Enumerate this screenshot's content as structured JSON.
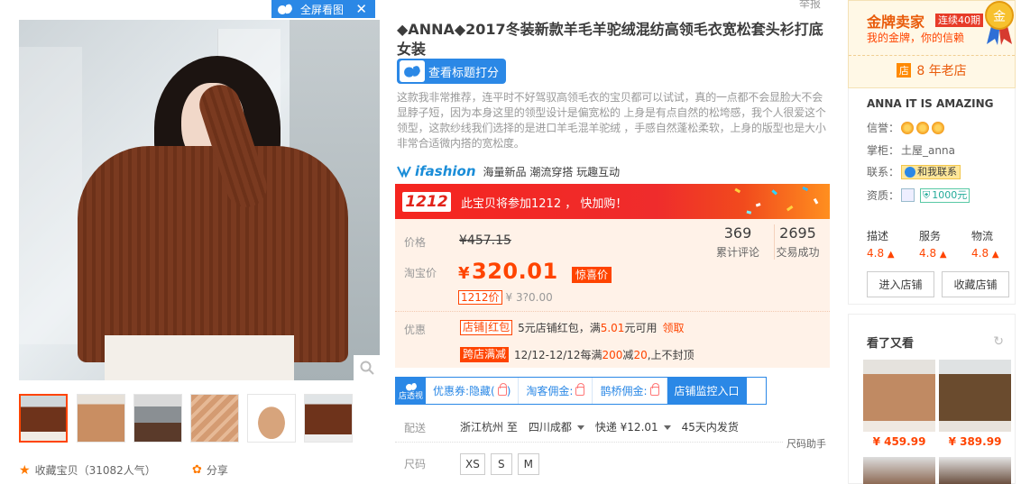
{
  "gallery": {
    "fullscreen_label": "全屏看图",
    "favorite_label": "收藏宝贝（31082人气）",
    "share_label": "分享"
  },
  "report_label": "举报",
  "title": "◆ANNA◆2017冬装新款羊毛羊驼绒混纺高领毛衣宽松套头衫打底女装",
  "score_button": "查看标题打分",
  "description": "这款我非常推荐，连平时不好驾驭高领毛衣的宝贝都可以试试，真的一点都不会显脸大不会显脖子短，因为本身这里的领型设计是偏宽松的 上身是有点自然的松垮感，我个人很爱这个领型，这款纱线我们选择的是进口羊毛混羊驼绒 ，手感自然蓬松柔软，上身的版型也是大小非常合适微内搭的宽松度。",
  "ifashion": {
    "brand": "ifashion",
    "tags": "海量新品 潮流穿搭 玩趣互动"
  },
  "promo": {
    "tag": "1212",
    "text": "此宝贝将参加1212 ， 快加购！"
  },
  "price": {
    "orig_label": "价格",
    "orig_value": "¥457.15",
    "cur_label": "淘宝价",
    "currency": "¥",
    "cur_value": "320.01",
    "xi_badge": "惊喜价",
    "p1212_badge": "1212价",
    "p1212_value": "¥ 3?0.00"
  },
  "stats": {
    "reviews_count": "369",
    "reviews_label": "累计评论",
    "sales_count": "2695",
    "sales_label": "交易成功"
  },
  "coupon": {
    "label": "优惠",
    "shop_chip": "店铺",
    "shop_chip2": "红包",
    "shop_text": "5元店铺红包，满",
    "shop_amount": "5.01",
    "shop_text2": "元可用",
    "get_label": "领取",
    "cross_chip": "跨店满减",
    "cross_text": "12/12-12/12每满",
    "cross_a": "200",
    "cross_mid": "减",
    "cross_b": "20",
    "cross_end": ",上不封顶"
  },
  "tools": {
    "logo": "店透视",
    "items": [
      "优惠券:隐藏(",
      "淘客佣金:",
      "鹊桥佣金:"
    ],
    "monitor": "店铺监控入口"
  },
  "ship": {
    "label": "配送",
    "from": "浙江杭州 至",
    "to": "四川成都",
    "express": "快递 ¥12.01",
    "eta": "45天内发货",
    "size_assist": "尺码助手"
  },
  "size": {
    "label": "尺码",
    "options": [
      "XS",
      "S",
      "M"
    ]
  },
  "seller": {
    "gold_title": "金牌卖家",
    "gold_badge": "连续40期",
    "gold_sub": "我的金牌，你的信赖",
    "medal_char": "金",
    "old_shop_icon": "店",
    "old_shop": "8 年老店",
    "shop_name": "ANNA IT IS AMAZING",
    "credit_label": "信誉：",
    "owner_label": "掌柜：",
    "owner": "土屋_anna",
    "contact_label": "联系：",
    "contact_btn": "和我联系",
    "qual_label": "资质：",
    "deposit": "1000元",
    "rates": [
      {
        "label": "描述",
        "value": "4.8"
      },
      {
        "label": "服务",
        "value": "4.8"
      },
      {
        "label": "物流",
        "value": "4.8"
      }
    ],
    "enter_shop": "进入店铺",
    "fav_shop": "收藏店铺"
  },
  "seen": {
    "title": "看了又看",
    "items": [
      {
        "price": "¥ 459.99"
      },
      {
        "price": "¥ 389.99"
      }
    ]
  },
  "colors": {
    "accent": "#ff4400",
    "brand_blue": "#2b88e6",
    "promo_red": "#f5251f"
  }
}
